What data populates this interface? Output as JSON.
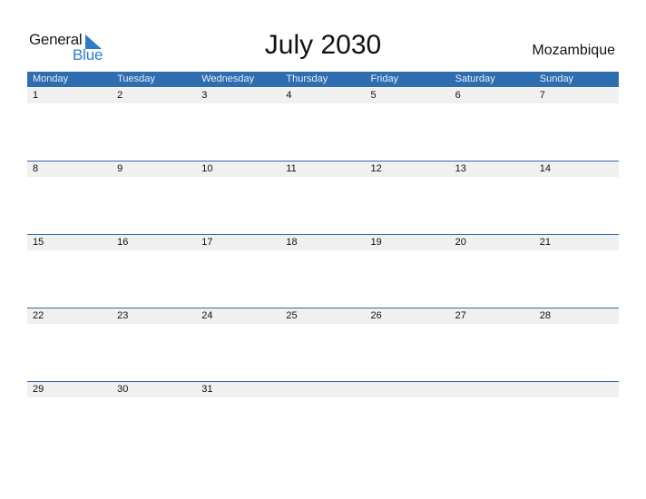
{
  "logo": {
    "general": "General",
    "blue": "Blue",
    "icon": "triangle-flag-icon"
  },
  "title": "July 2030",
  "country": "Mozambique",
  "colors": {
    "header": "#2e6db0",
    "strip": "#f0f0f0",
    "brand": "#2e7bc4"
  },
  "weekdays": [
    "Monday",
    "Tuesday",
    "Wednesday",
    "Thursday",
    "Friday",
    "Saturday",
    "Sunday"
  ],
  "weeks": [
    [
      "1",
      "2",
      "3",
      "4",
      "5",
      "6",
      "7"
    ],
    [
      "8",
      "9",
      "10",
      "11",
      "12",
      "13",
      "14"
    ],
    [
      "15",
      "16",
      "17",
      "18",
      "19",
      "20",
      "21"
    ],
    [
      "22",
      "23",
      "24",
      "25",
      "26",
      "27",
      "28"
    ],
    [
      "29",
      "30",
      "31",
      "",
      "",
      "",
      ""
    ]
  ]
}
